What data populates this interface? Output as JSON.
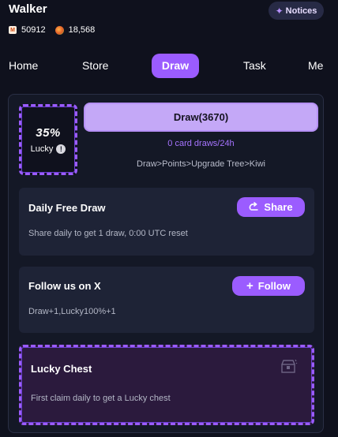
{
  "header": {
    "username": "Walker",
    "notices_label": "Notices",
    "points": "50912",
    "fruit": "18,568"
  },
  "nav": {
    "items": [
      "Home",
      "Store",
      "Draw",
      "Task",
      "Me"
    ],
    "active": "Draw"
  },
  "draw": {
    "lucky_value": "35%",
    "lucky_label": "Lucky",
    "draw_button": "Draw(3670)",
    "draws_info": "0 card draws/24h",
    "path_info": "Draw>Points>Upgrade Tree>Kiwi"
  },
  "daily": {
    "title": "Daily Free Draw",
    "button": "Share",
    "desc": "Share daily to get 1 draw, 0:00 UTC reset"
  },
  "follow": {
    "title": "Follow us on X",
    "button": "Follow",
    "desc": "Draw+1,Lucky100%+1"
  },
  "chest": {
    "title": "Lucky Chest",
    "desc": "First claim daily to get a Lucky chest"
  },
  "colors": {
    "accent": "#9b5cff",
    "background": "#0f111d",
    "card": "#1e2336"
  }
}
